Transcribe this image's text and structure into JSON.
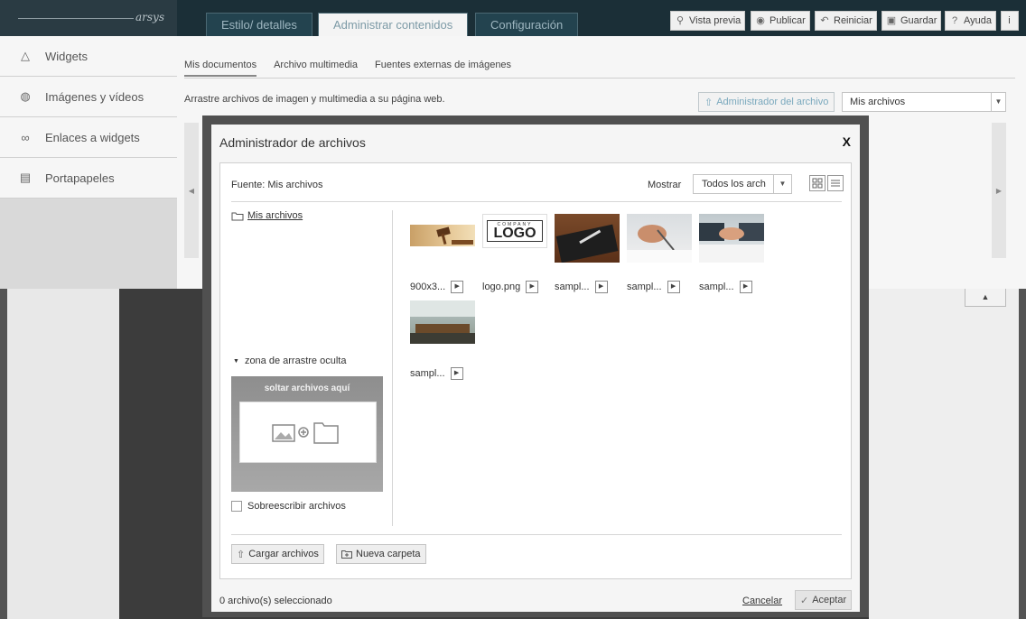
{
  "brand": {
    "logo_text": "arsys"
  },
  "main_tabs": [
    {
      "label": "Estilo/ detalles"
    },
    {
      "label": "Administrar contenidos"
    },
    {
      "label": "Configuración"
    }
  ],
  "toolbar": {
    "preview": "Vista previa",
    "publish": "Publicar",
    "reset": "Reiniciar",
    "save": "Guardar",
    "help": "Ayuda",
    "info": "i"
  },
  "sidebar": {
    "items": [
      {
        "label": "Widgets",
        "icon": "widget-icon"
      },
      {
        "label": "Imágenes y vídeos",
        "icon": "camera-icon"
      },
      {
        "label": "Enlaces a widgets",
        "icon": "link-icon"
      },
      {
        "label": "Portapapeles",
        "icon": "clipboard-icon"
      }
    ]
  },
  "content": {
    "subtabs": [
      "Mis documentos",
      "Archivo multimedia",
      "Fuentes externas de imágenes"
    ],
    "drag_hint": "Arrastre archivos de imagen y multimedia a su página web.",
    "admin_button": "Administrador del archivo",
    "files_select": "Mis archivos"
  },
  "modal": {
    "title": "Administrador de archivos",
    "close": "X",
    "source": "Fuente: Mis archivos",
    "show_label": "Mostrar",
    "show_value": "Todos los arch",
    "folder_root": "Mis archivos",
    "drop_toggle": "zona de arrastre oculta",
    "drop_label": "soltar archivos aquí",
    "overwrite": "Sobreescribir archivos",
    "files": [
      {
        "name": "900x3..."
      },
      {
        "name": "logo.png"
      },
      {
        "name": "sampl..."
      },
      {
        "name": "sampl..."
      },
      {
        "name": "sampl..."
      },
      {
        "name": "sampl..."
      }
    ],
    "logo_thumb": {
      "small": "COMPANY",
      "big": "LOGO"
    },
    "upload_button": "Cargar archivos",
    "new_folder_button": "Nueva carpeta",
    "selected_count": "0 archivo(s) seleccionado",
    "cancel": "Cancelar",
    "accept": "Aceptar"
  },
  "colors": {
    "topbar": "#1b2f37",
    "active_tab_text": "#7c9aa6",
    "admin_button_text": "#79a8bd"
  }
}
